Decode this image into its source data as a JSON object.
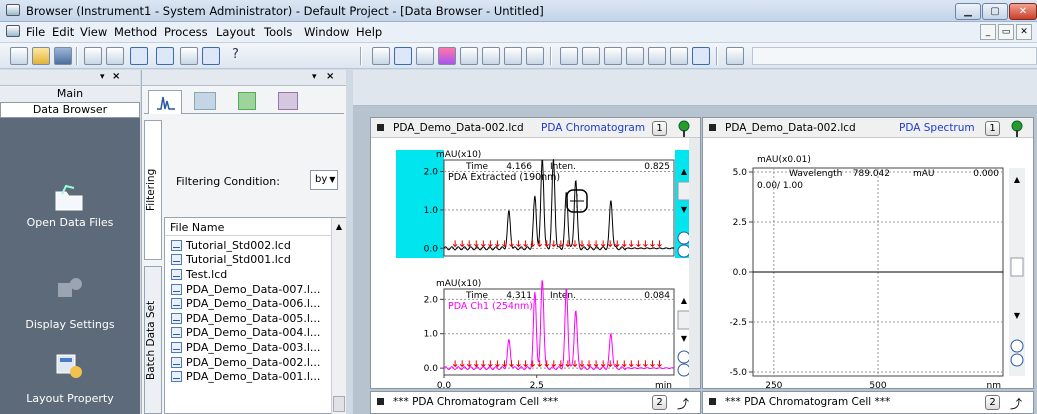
{
  "window": {
    "title": "Browser (Instrument1 - System Administrator) - Default Project - [Data Browser - Untitled]"
  },
  "menu": [
    "File",
    "Edit",
    "View",
    "Method",
    "Process",
    "Layout",
    "Tools",
    "Window",
    "Help"
  ],
  "left_panel": {
    "tabs": [
      "Main",
      "Data Browser"
    ],
    "nav": [
      "Open Data Files",
      "Display Settings",
      "Layout Property"
    ]
  },
  "middle_panel": {
    "vertical_tabs": [
      "Filtering",
      "Batch Data Set"
    ],
    "filter_label": "Filtering Condition:",
    "filter_value": "by",
    "column_header": "File Name",
    "files": [
      "Tutorial_Std002.lcd",
      "Tutorial_Std001.lcd",
      "Test.lcd",
      "PDA_Demo_Data-007.l...",
      "PDA_Demo_Data-006.l...",
      "PDA_Demo_Data-005.l...",
      "PDA_Demo_Data-004.l...",
      "PDA_Demo_Data-003.l...",
      "PDA_Demo_Data-002.l...",
      "PDA_Demo_Data-001.l..."
    ]
  },
  "panels": {
    "chrom": {
      "file": "PDA_Demo_Data-002.lcd",
      "type": "PDA Chromatogram",
      "num": "1"
    },
    "spec": {
      "file": "PDA_Demo_Data-002.lcd",
      "type": "PDA Spectrum",
      "num": "1"
    },
    "cell_left": {
      "label": "*** PDA Chromatogram Cell ***",
      "num": "2"
    },
    "cell_right": {
      "label": "*** PDA Chromatogram Cell ***",
      "num": "2"
    }
  },
  "chart_data": [
    {
      "type": "line",
      "unit": "mAU(x10)",
      "readout": {
        "time_label": "Time",
        "time": "4.166",
        "inten_label": "Inten.",
        "inten": "0.825"
      },
      "series": [
        {
          "name": "PDA Extracted (190nm)",
          "color": "#000000"
        }
      ],
      "y_ticks": [
        "0.0",
        "1.0",
        "2.0"
      ],
      "ylim": [
        -0.2,
        2.3
      ],
      "xlim": [
        0,
        6.2
      ],
      "peaks": [
        {
          "x": 1.75,
          "h": 0.95
        },
        {
          "x": 2.45,
          "h": 1.35
        },
        {
          "x": 2.65,
          "h": 2.35
        },
        {
          "x": 2.95,
          "h": 2.3
        },
        {
          "x": 3.3,
          "h": 1.45
        },
        {
          "x": 3.55,
          "h": 1.8
        },
        {
          "x": 4.5,
          "h": 1.25
        }
      ],
      "highlight_color": "#00e5ee"
    },
    {
      "type": "line",
      "unit": "mAU(x10)",
      "readout": {
        "time_label": "Time",
        "time": "4.311",
        "inten_label": "Inten.",
        "inten": "0.084"
      },
      "series": [
        {
          "name": "PDA Ch1 (254nm)",
          "color": "#ff00ff"
        }
      ],
      "y_ticks": [
        "0.0",
        "1.0",
        "2.0"
      ],
      "x_ticks": [
        "0.0",
        "2.5",
        "min"
      ],
      "ylim": [
        -0.2,
        2.3
      ],
      "xlim": [
        0,
        6.2
      ],
      "peaks": [
        {
          "x": 1.75,
          "h": 0.8
        },
        {
          "x": 2.45,
          "h": 2.2
        },
        {
          "x": 2.65,
          "h": 2.6
        },
        {
          "x": 3.3,
          "h": 2.3
        },
        {
          "x": 3.55,
          "h": 1.7
        },
        {
          "x": 4.5,
          "h": 1.0
        }
      ]
    },
    {
      "type": "line",
      "unit": "mAU(x0.01)",
      "readout": {
        "wl_label": "Wavelength",
        "wl": "789.042",
        "unit_label": "mAU",
        "value": "0.000"
      },
      "range_text": "0.00/ 1.00",
      "y_ticks": [
        "5.0",
        "2.5",
        "0.0",
        "-2.5",
        "-5.0"
      ],
      "x_ticks": [
        "250",
        "500",
        "nm"
      ],
      "ylim": [
        -5.2,
        5.2
      ],
      "xlim": [
        200,
        800
      ]
    }
  ]
}
